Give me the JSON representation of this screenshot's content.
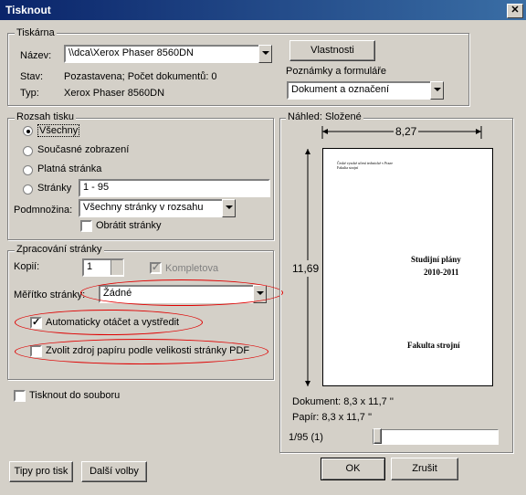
{
  "window": {
    "title": "Tisknout"
  },
  "printer": {
    "group": "Tiskárna",
    "name_label": "Název:",
    "name_value": "\\\\dca\\Xerox Phaser 8560DN",
    "properties_button": "Vlastnosti",
    "status_label": "Stav:",
    "status_value": "Pozastavena; Počet dokumentů: 0",
    "type_label": "Typ:",
    "type_value": "Xerox Phaser 8560DN",
    "comments_label": "Poznámky a formuláře",
    "comments_value": "Dokument a označení"
  },
  "range": {
    "group": "Rozsah tisku",
    "all": "Všechny",
    "current": "Současné zobrazení",
    "valid": "Platná stránka",
    "pages": "Stránky",
    "pages_value": "1 - 95",
    "subset_label": "Podmnožina:",
    "subset_value": "Všechny stránky v rozsahu",
    "reverse": "Obrátit stránky"
  },
  "handling": {
    "group": "Zpracování stránky",
    "copies_label": "Kopií:",
    "copies_value": "1",
    "collate": "Kompletova",
    "scale_label": "Měřítko stránky:",
    "scale_value": "Žádné",
    "autorotate": "Automaticky otáčet a vystředit",
    "pdf_source": "Zvolit zdroj papíru podle velikosti stránky PDF"
  },
  "print_to_file": "Tisknout do souboru",
  "preview": {
    "title": "Náhled: Složené",
    "width": "8,27",
    "height": "11,69",
    "page_small_line1": "České vysoké učení technické v Praze",
    "page_small_line2": "Fakulta strojní",
    "page_title1": "Studijní plány",
    "page_title2": "2010-2011",
    "page_footer": "Fakulta strojní",
    "document": "Dokument: 8,3 x 11,7 ''",
    "paper": "Papír: 8,3 x 11,7 ''",
    "page_counter": "1/95 (1)",
    "slider_position": 0
  },
  "buttons": {
    "tips": "Tipy pro tisk",
    "advanced": "Další volby",
    "ok": "OK",
    "cancel": "Zrušit"
  },
  "colors": {
    "title_bar": "#0a246a",
    "annotation": "#e00000",
    "dialog": "#d4d0c8"
  }
}
